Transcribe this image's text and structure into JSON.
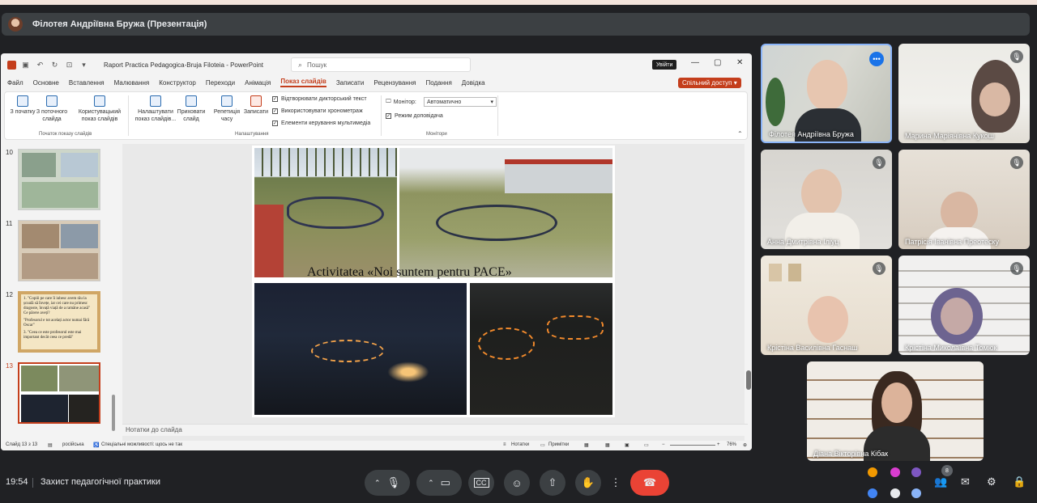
{
  "presenter": {
    "title": "Філотея Андріївна Бружа (Презентація)"
  },
  "ppt": {
    "doc_title": "Raport Practica Pedagogica-Bruja Filoteia  -  PowerPoint",
    "search_placeholder": "Пошук",
    "signin": "Увійти",
    "share": "Спільний доступ",
    "menu": [
      "Файл",
      "Основне",
      "Вставлення",
      "Малювання",
      "Конструктор",
      "Переходи",
      "Анімація",
      "Показ слайдів",
      "Записати",
      "Рецензування",
      "Подання",
      "Довідка"
    ],
    "active_menu_index": 7,
    "ribbon": {
      "from_start": "З початку",
      "from_current": "З поточного слайда",
      "custom_show": "Користувацький показ слайдів",
      "setup": "Налаштувати показ слайдів...",
      "hide": "Приховати слайд",
      "rehearse": "Репетиція часу",
      "record": "Записати",
      "play_narration": "Відтворювати дикторський текст",
      "use_timings": "Використовувати хронометраж",
      "media_controls": "Елементи керування мультимедіа",
      "monitor_label": "Монітор:",
      "monitor_value": "Автоматично",
      "presenter_view": "Режим доповідача",
      "group_start": "Початок показу слайдів",
      "group_setup": "Налаштування",
      "group_monitors": "Монітори"
    },
    "thumbnails": [
      {
        "number": "10"
      },
      {
        "number": "11"
      },
      {
        "number": "12",
        "text": [
          "1. \"Copiii pe care îi iubesc avem rău la școală să învețe, iar cei care nu primesc dragoste, învață viață de a ramâne acasă\" Ce părere aveți?",
          "\"Profesorul e tot acelați actor numai fără Oscar\"",
          "3. \"Ceea ce este profesorul este mai important decât ceea ce predă\""
        ]
      },
      {
        "number": "13"
      }
    ],
    "slide_caption": "Activitatea «Noi suntem pentru PACE»",
    "notes_placeholder": "Нотатки до слайда",
    "status": {
      "slide": "Слайд 13 з 13",
      "language": "російська",
      "accessibility": "Спеціальні можливості: щось не так",
      "notes": "Нотатки",
      "comments": "Примітки",
      "zoom": "76%"
    }
  },
  "participants": [
    {
      "name": "Філотея Андріївна Бружа",
      "active": true
    },
    {
      "name": "Марина Маріянівна Кукош"
    },
    {
      "name": "Анна Дмитрівна Іліуц"
    },
    {
      "name": "Патрісія Іванівна Преотеску"
    },
    {
      "name": "Крістіна Василівна Гаснаш"
    },
    {
      "name": "Крістіна Миколаївна Томюк"
    },
    {
      "name": "Діана Вікторівна Кібак"
    }
  ],
  "bottom": {
    "time": "19:54",
    "meeting": "Захист педагогічної практики",
    "participant_count": "8"
  }
}
